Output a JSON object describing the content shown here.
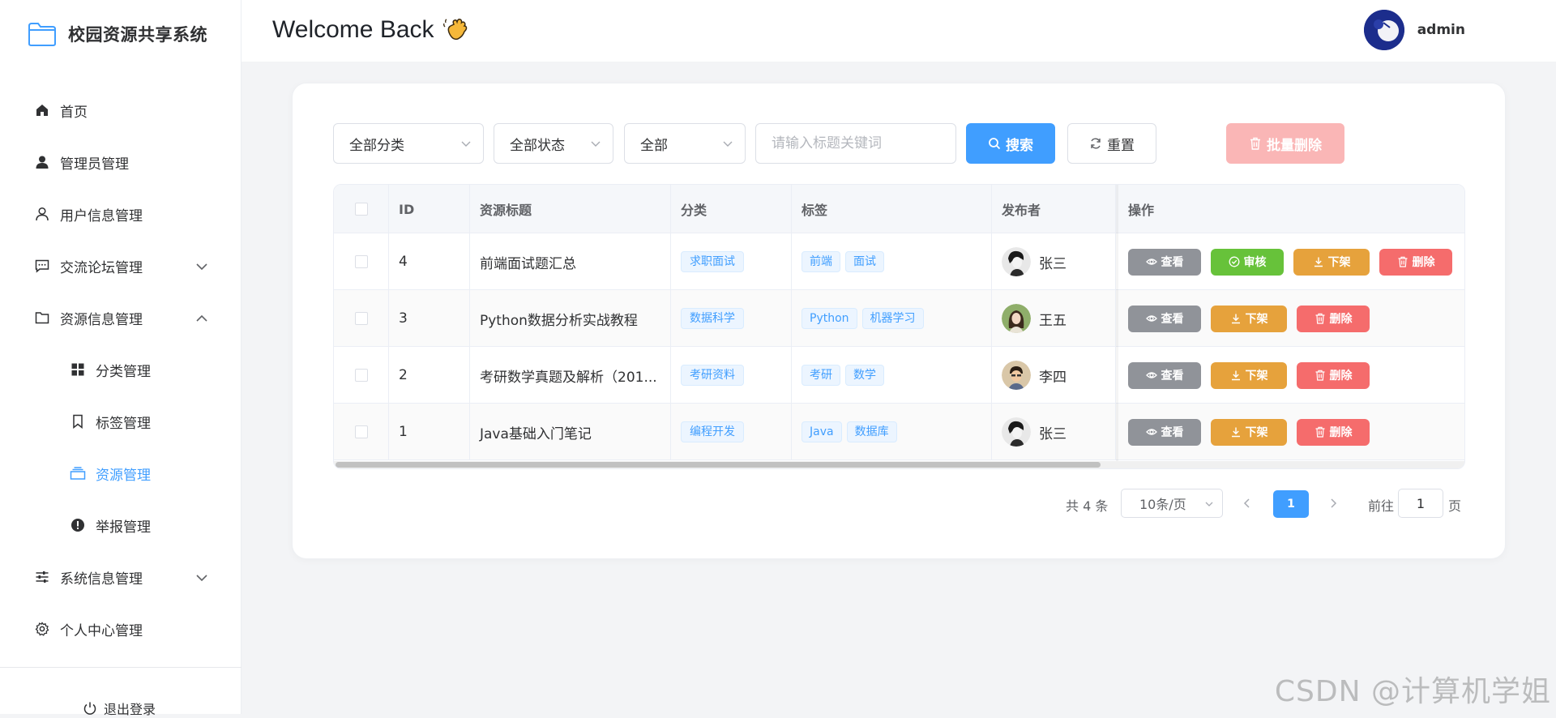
{
  "app": {
    "title": "校园资源共享系统"
  },
  "sidebar": {
    "items": [
      {
        "label": "首页",
        "icon": "home-icon"
      },
      {
        "label": "管理员管理",
        "icon": "user-icon"
      },
      {
        "label": "用户信息管理",
        "icon": "user-outline-icon"
      },
      {
        "label": "交流论坛管理",
        "icon": "chat-icon"
      },
      {
        "label": "资源信息管理",
        "icon": "folder-icon"
      },
      {
        "label": "分类管理",
        "icon": "grid-icon"
      },
      {
        "label": "标签管理",
        "icon": "bookmark-icon"
      },
      {
        "label": "资源管理",
        "icon": "stack-icon"
      },
      {
        "label": "举报管理",
        "icon": "warning-icon"
      },
      {
        "label": "系统信息管理",
        "icon": "sliders-icon"
      },
      {
        "label": "个人中心管理",
        "icon": "gear-icon"
      }
    ],
    "logout": "退出登录"
  },
  "header": {
    "welcome": "Welcome Back",
    "username": "admin"
  },
  "filters": {
    "category": "全部分类",
    "status": "全部状态",
    "scope": "全部",
    "search_placeholder": "请输入标题关键词",
    "search_label": "搜索",
    "reset_label": "重置",
    "batch_delete_label": "批量删除"
  },
  "table": {
    "columns": [
      "ID",
      "资源标题",
      "分类",
      "标签",
      "发布者",
      "操作"
    ],
    "rows": [
      {
        "id": "4",
        "title": "前端面试题汇总",
        "category": "求职面试",
        "tags": [
          "前端",
          "面试"
        ],
        "publisher": "张三"
      },
      {
        "id": "3",
        "title": "Python数据分析实战教程",
        "category": "数据科学",
        "tags": [
          "Python",
          "机器学习"
        ],
        "publisher": "王五"
      },
      {
        "id": "2",
        "title": "考研数学真题及解析（201...",
        "category": "考研资料",
        "tags": [
          "考研",
          "数学"
        ],
        "publisher": "李四"
      },
      {
        "id": "1",
        "title": "Java基础入门笔记",
        "category": "编程开发",
        "tags": [
          "Java",
          "数据库"
        ],
        "publisher": "张三"
      }
    ],
    "actions": {
      "view": "查看",
      "audit": "审核",
      "offline": "下架",
      "delete": "删除"
    }
  },
  "pagination": {
    "total": "共 4 条",
    "page_size": "10条/页",
    "current": "1",
    "goto_prefix": "前往",
    "goto_value": "1",
    "goto_suffix": "页"
  },
  "watermark": "CSDN @计算机学姐",
  "colors": {
    "primary": "#409eff",
    "success": "#67c23a",
    "warning": "#e6a23c",
    "danger": "#f56c6c",
    "info": "#909399"
  }
}
